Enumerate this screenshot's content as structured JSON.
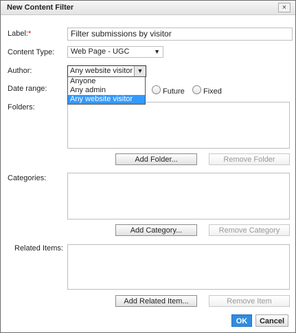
{
  "dialog": {
    "title": "New Content Filter",
    "close_label": "×"
  },
  "fields": {
    "label": {
      "label": "Label:",
      "required_mark": "*",
      "value": "Filter submissions by visitor"
    },
    "content_type": {
      "label": "Content Type:",
      "value": "Web Page - UGC"
    },
    "author": {
      "label": "Author:",
      "value": "Any website visitor",
      "options": [
        "Anyone",
        "Any admin",
        "Any website visitor"
      ]
    },
    "date_range": {
      "label": "Date range:",
      "options": [
        "Future",
        "Fixed"
      ]
    },
    "folders": {
      "label": "Folders:",
      "add": "Add Folder...",
      "remove": "Remove Folder"
    },
    "categories": {
      "label": "Categories:",
      "add": "Add Category...",
      "remove": "Remove Category"
    },
    "related": {
      "label": "Related Items:",
      "add": "Add Related Item...",
      "remove": "Remove Item"
    }
  },
  "footer": {
    "ok": "OK",
    "cancel": "Cancel"
  },
  "colors": {
    "primary_button": "#2f8de1",
    "selection": "#3399ff",
    "required": "#ee0000"
  }
}
